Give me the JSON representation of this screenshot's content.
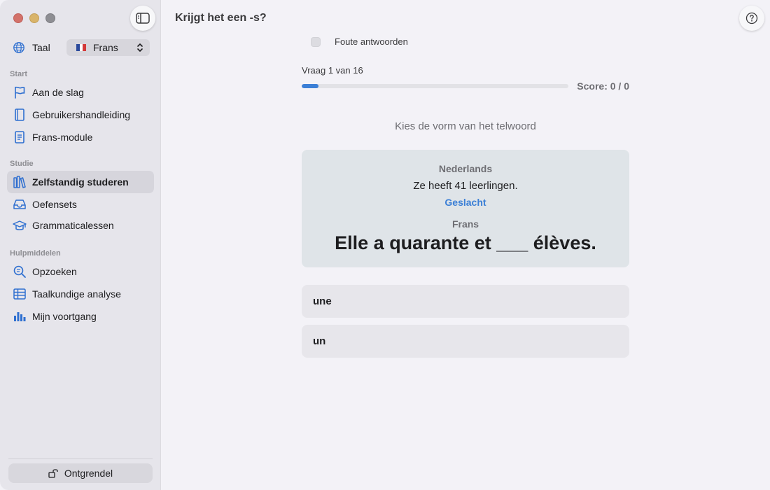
{
  "window": {
    "title": "Krijgt het een -s?"
  },
  "sidebar": {
    "language": {
      "label": "Taal",
      "selected": "Frans"
    },
    "sections": [
      {
        "title": "Start",
        "items": [
          {
            "label": "Aan de slag",
            "icon": "flag-icon"
          },
          {
            "label": "Gebruikershandleiding",
            "icon": "book-icon"
          },
          {
            "label": "Frans-module",
            "icon": "document-icon"
          }
        ]
      },
      {
        "title": "Studie",
        "items": [
          {
            "label": "Zelfstandig studeren",
            "icon": "books-icon",
            "active": true
          },
          {
            "label": "Oefensets",
            "icon": "tray-icon"
          },
          {
            "label": "Grammaticalessen",
            "icon": "graduation-cap-icon"
          }
        ]
      },
      {
        "title": "Hulpmiddelen",
        "items": [
          {
            "label": "Opzoeken",
            "icon": "text-magnifier-icon"
          },
          {
            "label": "Taalkundige analyse",
            "icon": "table-icon"
          },
          {
            "label": "Mijn voortgang",
            "icon": "bar-chart-icon"
          }
        ]
      }
    ],
    "unlock_label": "Ontgrendel"
  },
  "quiz": {
    "wrong_answers_label": "Foute antwoorden",
    "question_counter": "Vraag 1 van 16",
    "progress_fraction": 0.0625,
    "score": "Score: 0 / 0",
    "instruction": "Kies de vorm van het telwoord",
    "card": {
      "source_label": "Nederlands",
      "source_sentence": "Ze heeft 41 leerlingen.",
      "hint": "Geslacht",
      "target_label": "Frans",
      "target_sentence": "Elle a quarante et ___ élèves."
    },
    "answers": [
      "une",
      "un"
    ]
  },
  "colors": {
    "accent": "#3b7fd6",
    "sidebar_bg": "#e6e5eb",
    "main_bg": "#f3f2f7",
    "card_bg": "#dfe4e8"
  }
}
